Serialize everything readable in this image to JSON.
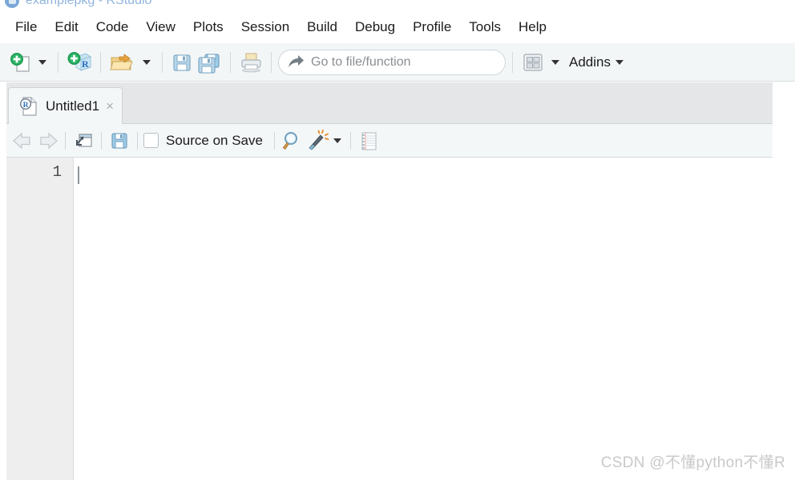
{
  "window": {
    "title": "examplepkg - RStudio",
    "app_icon": "rstudio-logo-icon"
  },
  "menubar": {
    "items": [
      {
        "label": "File"
      },
      {
        "label": "Edit"
      },
      {
        "label": "Code"
      },
      {
        "label": "View"
      },
      {
        "label": "Plots"
      },
      {
        "label": "Session"
      },
      {
        "label": "Build"
      },
      {
        "label": "Debug"
      },
      {
        "label": "Profile"
      },
      {
        "label": "Tools"
      },
      {
        "label": "Help"
      }
    ]
  },
  "toolbar": {
    "new_file_icon": "new-file-icon",
    "new_file_caret": "chevron-down-icon",
    "new_project_icon": "new-project-icon",
    "open_file_icon": "open-file-icon",
    "open_file_caret": "chevron-down-icon",
    "save_icon": "save-icon",
    "save_all_icon": "save-all-icon",
    "print_icon": "print-icon",
    "goto": {
      "icon": "goto-arrow-icon",
      "placeholder": "Go to file/function",
      "value": ""
    },
    "pane_layout_icon": "pane-layout-icon",
    "pane_layout_caret": "chevron-down-icon",
    "addins_label": "Addins",
    "addins_caret": "chevron-down-icon"
  },
  "source_pane": {
    "tab": {
      "icon": "r-script-icon",
      "label": "Untitled1",
      "close": "×"
    },
    "editor_toolbar": {
      "back_icon": "arrow-left-icon",
      "forward_icon": "arrow-right-icon",
      "popout_icon": "show-in-new-window-icon",
      "save_icon": "save-icon",
      "source_on_save_label": "Source on Save",
      "source_on_save_checked": false,
      "find_icon": "magnifier-icon",
      "code_tools_icon": "magic-wand-icon",
      "code_tools_caret": "chevron-down-icon",
      "compile_report_icon": "notebook-icon"
    },
    "editor": {
      "line_numbers": [
        "1"
      ],
      "lines": [
        ""
      ],
      "cursor_line": 1,
      "cursor_column": 1
    }
  },
  "watermark": {
    "text": "CSDN @不懂python不懂R"
  },
  "colors": {
    "toolbar_bg": "#f3f6f7",
    "tabbar_bg": "#e4e6e8",
    "active_tab_bg": "#f4f7f8",
    "gutter_bg": "#eeeeee",
    "editor_bg": "#ffffff",
    "text": "#1b1b1b",
    "title_text": "#8fb4dd",
    "placeholder_text": "#8b8f93",
    "watermark_text": "#c9c9c9",
    "accent_green": "#1f9d55",
    "accent_blue": "#2a6ebb"
  }
}
